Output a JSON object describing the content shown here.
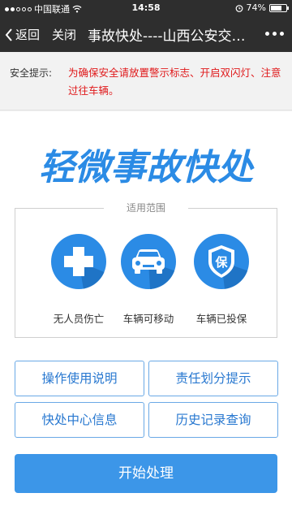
{
  "status_bar": {
    "carrier": "中国联通",
    "time": "14:58",
    "battery": "74%",
    "battery_level": 0.74
  },
  "nav": {
    "back_label": "返回",
    "close_label": "关闭",
    "title": "事故快处----山西公安交…"
  },
  "notice": {
    "label": "安全提示:",
    "text": "为确保安全请放置警示标志、开启双闪灯、注意过往车辆。"
  },
  "logo_text": "轻微事故快处",
  "scope": {
    "title": "适用范围",
    "items": [
      {
        "label": "无人员伤亡",
        "icon": "medical-cross-icon"
      },
      {
        "label": "车辆可移动",
        "icon": "car-icon"
      },
      {
        "label": "车辆已投保",
        "icon": "insurance-shield-icon",
        "badge": "保"
      }
    ]
  },
  "actions": {
    "guide": "操作使用说明",
    "liability": "责任划分提示",
    "center_info": "快处中心信息",
    "history": "历史记录查询",
    "start": "开始处理"
  },
  "colors": {
    "accent": "#2b8be5",
    "warning": "#e0191b",
    "button_border": "#6aa9e6"
  }
}
